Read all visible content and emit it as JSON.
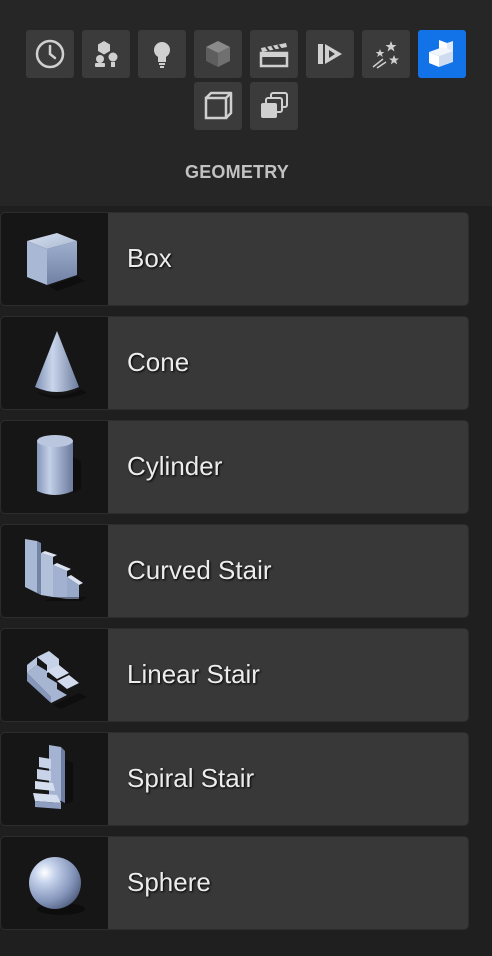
{
  "toolbar": {
    "row1": [
      {
        "icon": "recent-clock-icon",
        "active": false
      },
      {
        "icon": "basic-shapes-icon",
        "active": false
      },
      {
        "icon": "lightbulb-icon",
        "active": false
      },
      {
        "icon": "cube-icon",
        "active": false
      },
      {
        "icon": "clapperboard-icon",
        "active": false
      },
      {
        "icon": "play-volume-icon",
        "active": false
      },
      {
        "icon": "sparkle-stars-icon",
        "active": false
      },
      {
        "icon": "geometry-blocks-icon",
        "active": true
      }
    ],
    "row2": [
      {
        "icon": "box-outline-icon",
        "active": false
      },
      {
        "icon": "stacked-layers-icon",
        "active": false
      }
    ],
    "accent_color": "#1273e8"
  },
  "section": {
    "title": "GEOMETRY"
  },
  "items": [
    {
      "label": "Box",
      "icon": "box-thumbnail-icon"
    },
    {
      "label": "Cone",
      "icon": "cone-thumbnail-icon"
    },
    {
      "label": "Cylinder",
      "icon": "cylinder-thumbnail-icon"
    },
    {
      "label": "Curved Stair",
      "icon": "curved-stair-thumbnail-icon"
    },
    {
      "label": "Linear Stair",
      "icon": "linear-stair-thumbnail-icon"
    },
    {
      "label": "Spiral Stair",
      "icon": "spiral-stair-thumbnail-icon"
    },
    {
      "label": "Sphere",
      "icon": "sphere-thumbnail-icon"
    }
  ]
}
